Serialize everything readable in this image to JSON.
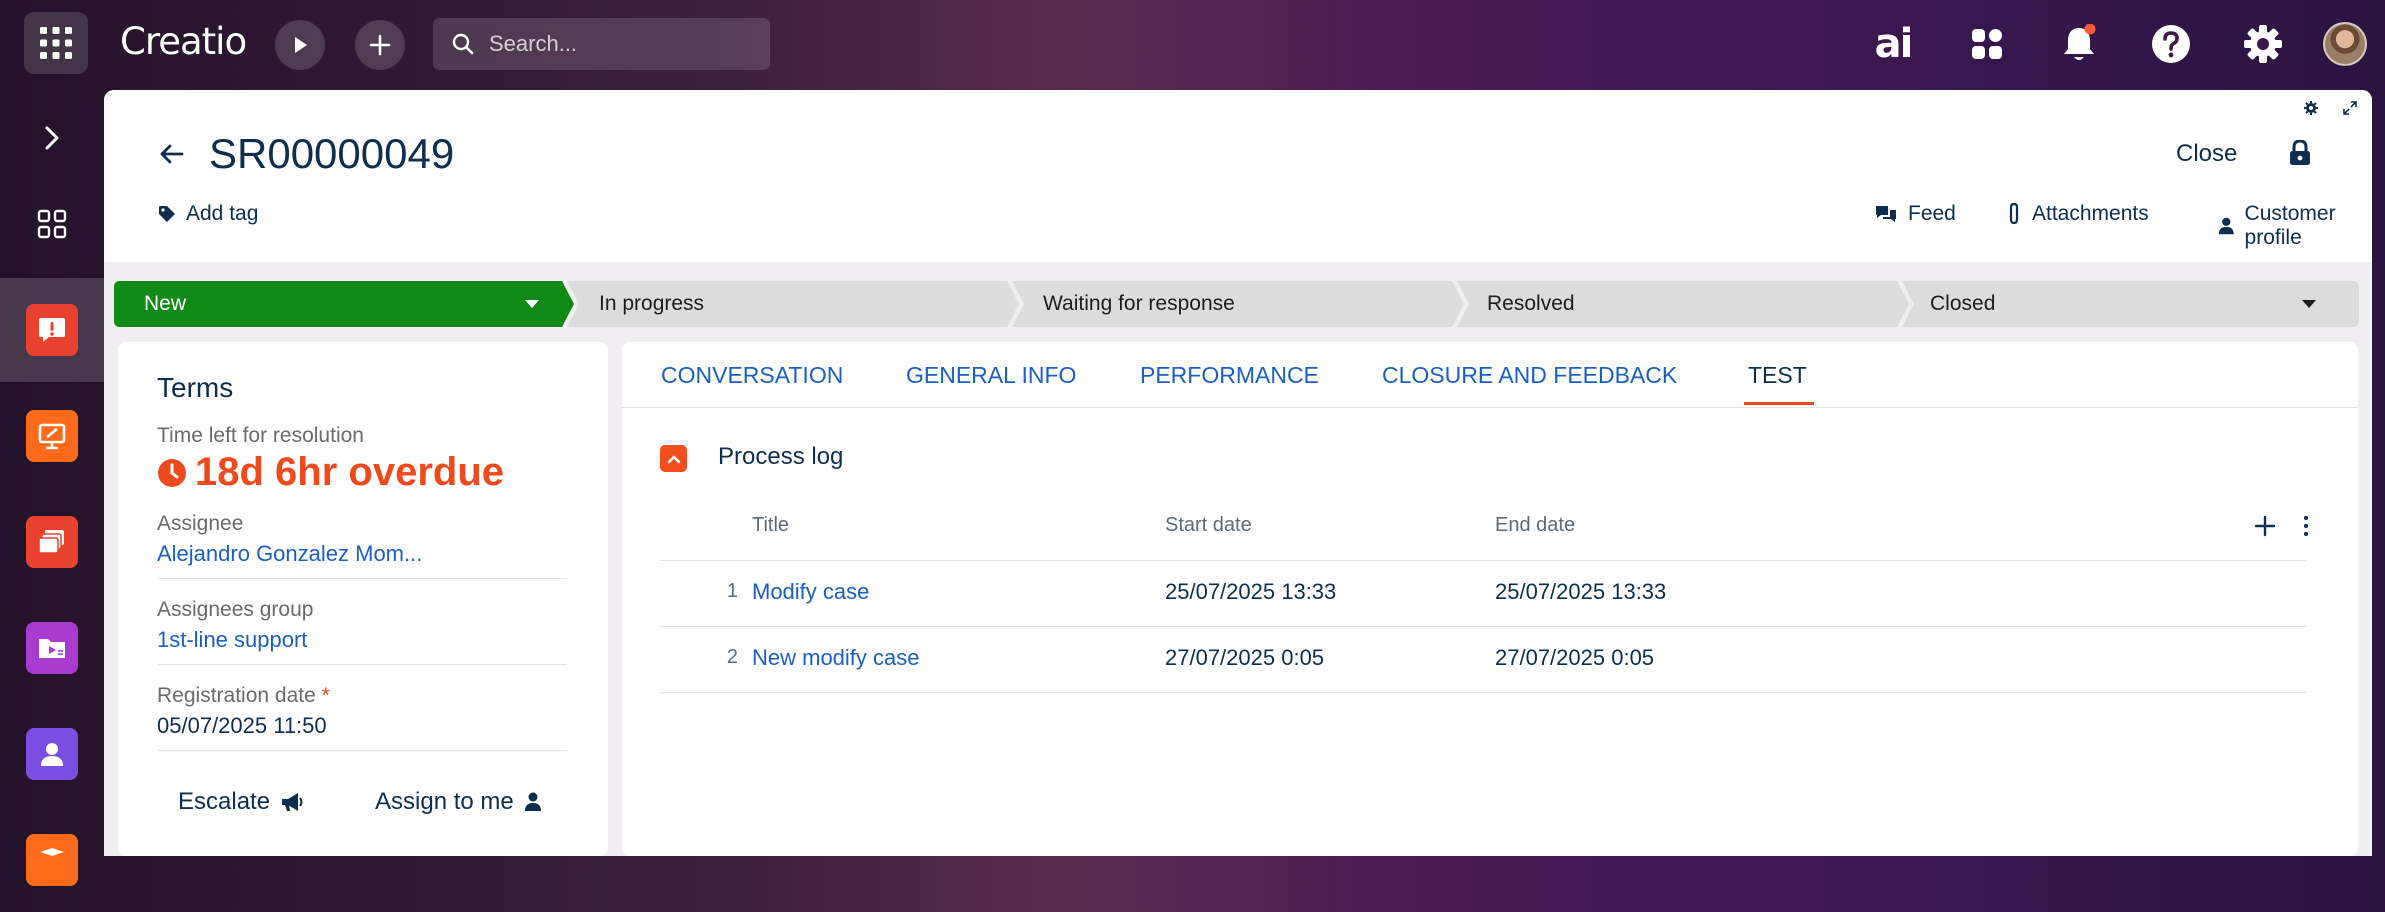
{
  "topbar": {
    "logo_text": "Creatio",
    "search": {
      "placeholder": "Search..."
    },
    "ai_label": "ai",
    "notification_dot_color": "#ff5a36"
  },
  "sidebar": {
    "items": [
      {
        "name": "expand",
        "icon": "chevron-right-icon"
      },
      {
        "name": "apps",
        "icon": "grid-icon"
      },
      {
        "name": "cases",
        "icon": "alert-icon",
        "color": "#e8422f",
        "active": true
      },
      {
        "name": "presentation",
        "icon": "presentation-icon",
        "color": "#ff6a1a"
      },
      {
        "name": "cards",
        "icon": "cards-icon",
        "color": "#e8422f"
      },
      {
        "name": "folder",
        "icon": "folder-icon",
        "color": "#a93bcf"
      },
      {
        "name": "contacts",
        "icon": "person-icon",
        "color": "#7a4ee0"
      },
      {
        "name": "other",
        "icon": "box-icon",
        "color": "#ff6a1a"
      }
    ]
  },
  "header": {
    "title": "SR00000049",
    "add_tag": "Add tag",
    "close": "Close",
    "links": {
      "feed": "Feed",
      "attachments": "Attachments",
      "customer_profile": "Customer profile"
    }
  },
  "stages": [
    {
      "label": "New",
      "active": true,
      "color": "#0f8a16"
    },
    {
      "label": "In progress"
    },
    {
      "label": "Waiting for response"
    },
    {
      "label": "Resolved"
    },
    {
      "label": "Closed"
    }
  ],
  "terms": {
    "title": "Terms",
    "time_left_label": "Time left for resolution",
    "time_left_value": "18d 6hr overdue",
    "assignee_label": "Assignee",
    "assignee_value": "Alejandro Gonzalez Mom...",
    "group_label": "Assignees group",
    "group_value": "1st-line support",
    "reg_date_label": "Registration date",
    "reg_date_required": "*",
    "reg_date_value": "05/07/2025 11:50",
    "escalate": "Escalate",
    "assign_to_me": "Assign to me"
  },
  "tabs": [
    {
      "label": "CONVERSATION"
    },
    {
      "label": "GENERAL INFO"
    },
    {
      "label": "PERFORMANCE"
    },
    {
      "label": "CLOSURE AND FEEDBACK"
    },
    {
      "label": "TEST",
      "active": true
    }
  ],
  "process_log": {
    "title": "Process log",
    "columns": [
      "Title",
      "Start date",
      "End date"
    ],
    "rows": [
      {
        "num": "1",
        "title": "Modify case",
        "start": "25/07/2025 13:33",
        "end": "25/07/2025 13:33"
      },
      {
        "num": "2",
        "title": "New modify case",
        "start": "27/07/2025 0:05",
        "end": "27/07/2025 0:05"
      }
    ]
  }
}
